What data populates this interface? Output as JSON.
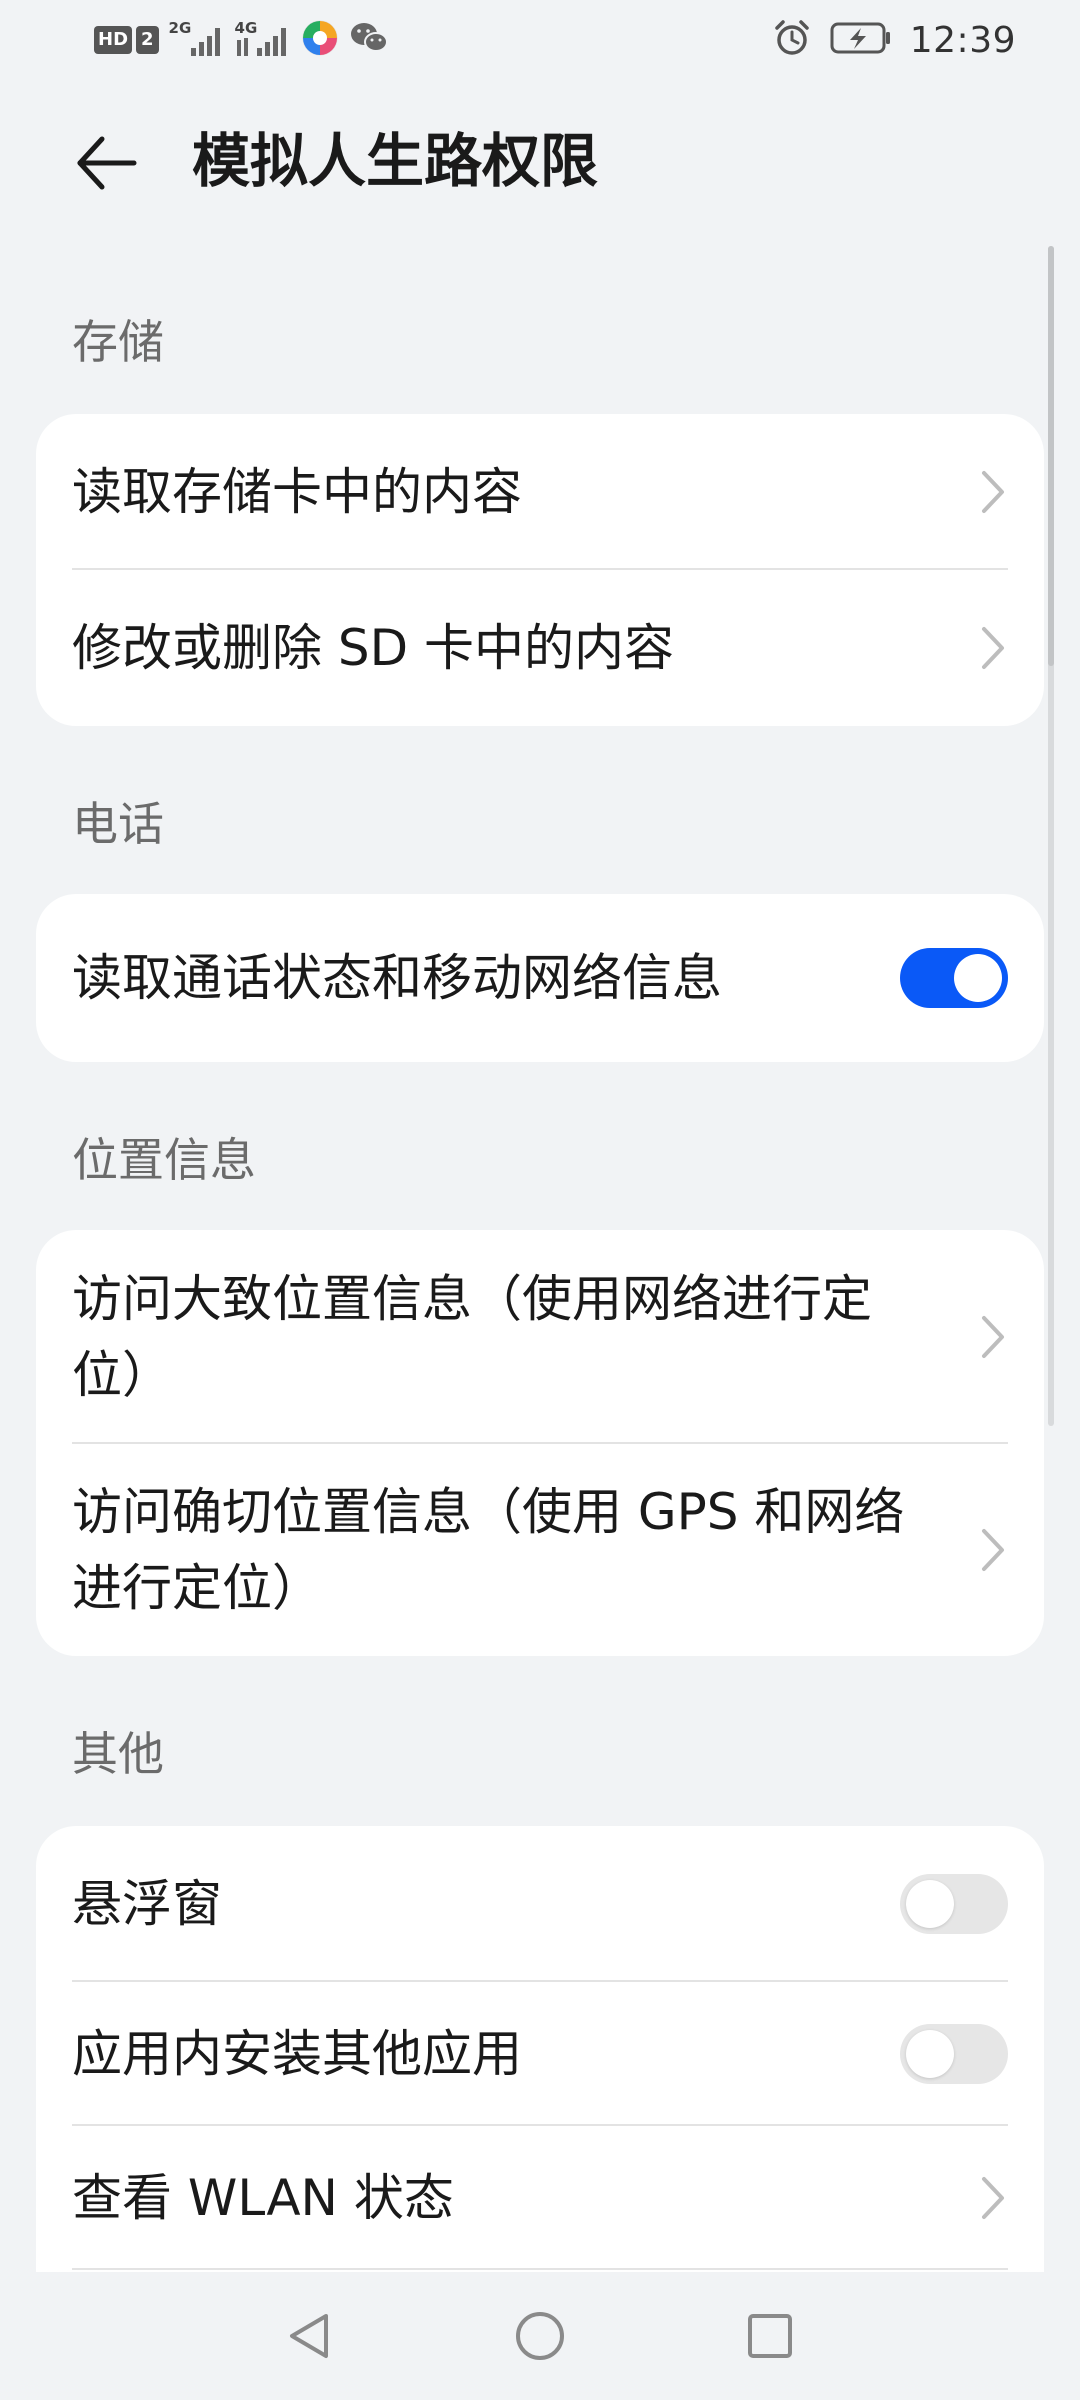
{
  "status_bar": {
    "hd_label": "HD",
    "sim_label": "2",
    "network_1": "2G",
    "network_2": "4G",
    "time": "12:39"
  },
  "header": {
    "back_icon": "arrow-left-icon",
    "title": "模拟人生路权限"
  },
  "sections": {
    "storage": {
      "label": "存储",
      "items": [
        {
          "label": "读取存储卡中的内容",
          "control": "chevron"
        },
        {
          "label": "修改或删除 SD 卡中的内容",
          "control": "chevron"
        }
      ]
    },
    "phone": {
      "label": "电话",
      "items": [
        {
          "label": "读取通话状态和移动网络信息",
          "control": "toggle",
          "enabled": true
        }
      ]
    },
    "location": {
      "label": "位置信息",
      "items": [
        {
          "label": "访问大致位置信息（使用网络进行定位）",
          "control": "chevron"
        },
        {
          "label": "访问确切位置信息（使用 GPS 和网络进行定位）",
          "control": "chevron"
        }
      ]
    },
    "other": {
      "label": "其他",
      "items": [
        {
          "label": "悬浮窗",
          "control": "toggle",
          "enabled": false
        },
        {
          "label": "应用内安装其他应用",
          "control": "toggle",
          "enabled": false
        },
        {
          "label": "查看 WLAN 状态",
          "control": "chevron"
        }
      ]
    }
  },
  "colors": {
    "accent": "#0a59f7",
    "background": "#f1f3f5",
    "card": "#ffffff",
    "section_label": "#6b6b6b"
  },
  "nav_bar": {
    "back": "triangle-back-icon",
    "home": "circle-home-icon",
    "recents": "square-recents-icon"
  }
}
